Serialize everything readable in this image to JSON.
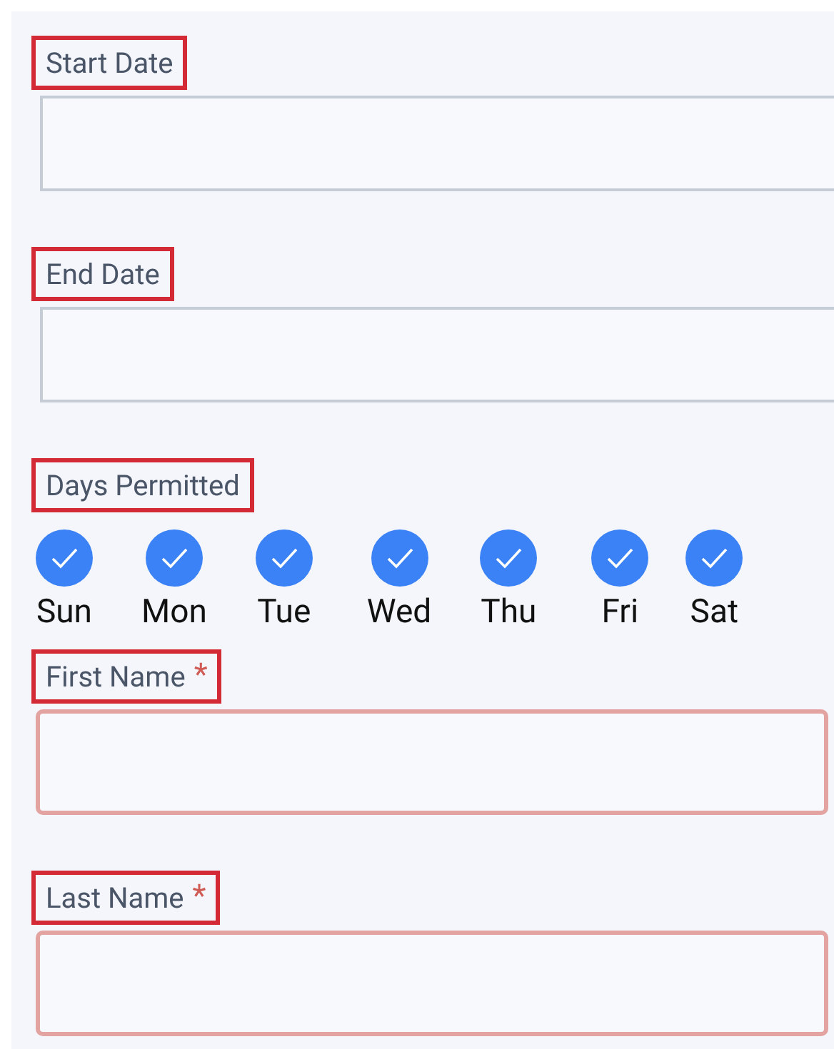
{
  "fields_top": [
    {
      "label": "Start Date",
      "highlighted": true,
      "error": false
    },
    {
      "label": "End Date",
      "highlighted": true,
      "error": false
    }
  ],
  "days_permitted": {
    "label": "Days Permitted",
    "highlighted": true,
    "days": [
      {
        "label": "Sun",
        "checked": true
      },
      {
        "label": "Mon",
        "checked": true
      },
      {
        "label": "Tue",
        "checked": true
      },
      {
        "label": "Wed",
        "checked": true
      },
      {
        "label": "Thu",
        "checked": true
      },
      {
        "label": "Fri",
        "checked": true
      },
      {
        "label": "Sat",
        "checked": true
      }
    ]
  },
  "fields_bottom": [
    {
      "label": "First Name",
      "highlighted": true,
      "required": true,
      "required_mark": "*",
      "error": true
    },
    {
      "label": "Last Name",
      "highlighted": true,
      "required": true,
      "required_mark": "*",
      "error": true
    }
  ]
}
